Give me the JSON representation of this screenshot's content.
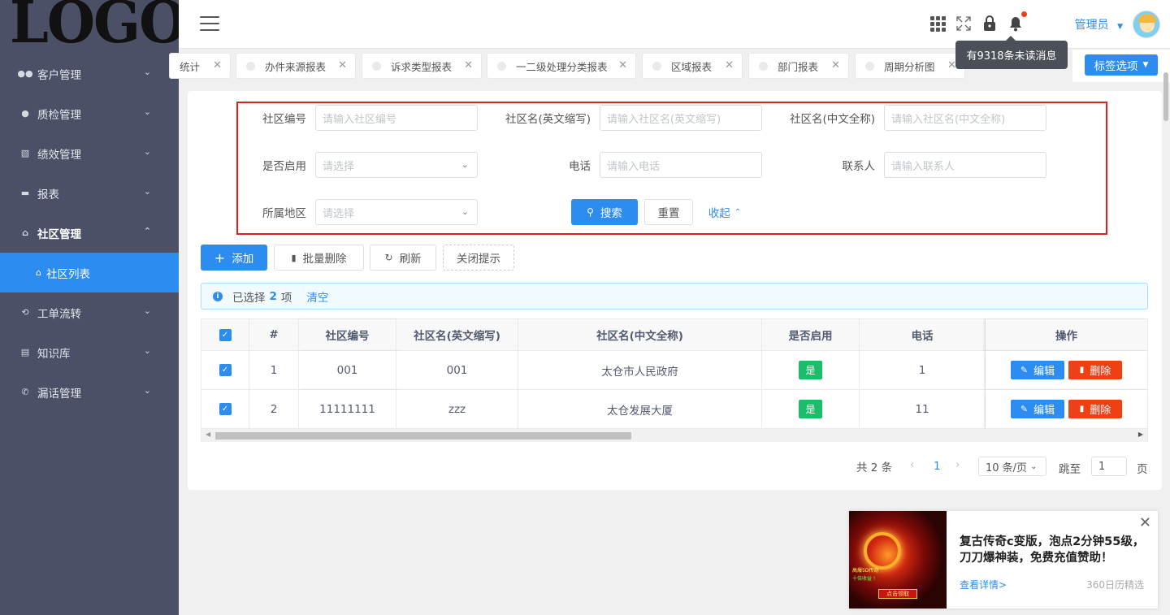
{
  "logo": "LOGO",
  "sidebar": {
    "items": [
      {
        "label": "客户管理",
        "icon": "people-icon"
      },
      {
        "label": "质检管理",
        "icon": "clock-icon"
      },
      {
        "label": "绩效管理",
        "icon": "chart-icon"
      },
      {
        "label": "报表",
        "icon": "folder-icon"
      },
      {
        "label": "社区管理",
        "icon": "home-icon"
      },
      {
        "label": "工单流转",
        "icon": "loop-icon"
      },
      {
        "label": "知识库",
        "icon": "book-icon"
      },
      {
        "label": "漏话管理",
        "icon": "phone-icon"
      }
    ],
    "active_sub": "社区列表"
  },
  "header": {
    "user": "管理员",
    "tooltip": "有9318条未读消息"
  },
  "tabs": [
    {
      "label": "统计"
    },
    {
      "label": "办件来源报表"
    },
    {
      "label": "诉求类型报表"
    },
    {
      "label": "一二级处理分类报表"
    },
    {
      "label": "区域报表"
    },
    {
      "label": "部门报表"
    },
    {
      "label": "周期分析图"
    }
  ],
  "tag_options": "标签选项",
  "filter": {
    "fields": [
      {
        "label": "社区编号",
        "placeholder": "请输入社区编号"
      },
      {
        "label": "社区名(英文缩写)",
        "placeholder": "请输入社区名(英文缩写)"
      },
      {
        "label": "社区名(中文全称)",
        "placeholder": "请输入社区名(中文全称)"
      },
      {
        "label": "是否启用",
        "placeholder": "请选择"
      },
      {
        "label": "电话",
        "placeholder": "请输入电话"
      },
      {
        "label": "联系人",
        "placeholder": "请输入联系人"
      },
      {
        "label": "所属地区",
        "placeholder": "请选择"
      }
    ],
    "search": "搜索",
    "reset": "重置",
    "collapse": "收起"
  },
  "toolbar": {
    "add": "添加",
    "batch_delete": "批量删除",
    "refresh": "刷新",
    "close_tip": "关闭提示"
  },
  "alert": {
    "prefix": "已选择",
    "count": "2",
    "suffix": "项",
    "clear": "清空"
  },
  "table": {
    "headers": [
      "#",
      "社区编号",
      "社区名(英文缩写)",
      "社区名(中文全称)",
      "是否启用",
      "电话",
      "操作"
    ],
    "rows": [
      {
        "idx": "1",
        "code": "001",
        "abbr": "001",
        "name": "太仓市人民政府",
        "enabled": "是",
        "phone": "1"
      },
      {
        "idx": "2",
        "code": "11111111",
        "abbr": "zzz",
        "name": "太仓发展大厦",
        "enabled": "是",
        "phone": "11"
      }
    ],
    "edit": "编辑",
    "delete": "删除"
  },
  "pager": {
    "total": "共 2 条",
    "page": "1",
    "size": "10 条/页",
    "jump": "跳至",
    "jump_value": "1",
    "page_unit": "页"
  },
  "ad": {
    "title": "复古传奇c变版，泡点2分钟55级，刀刀爆神装，免费充值赞助！",
    "more": "查看详情>",
    "source": "360日历精选",
    "button": "点击领取"
  }
}
